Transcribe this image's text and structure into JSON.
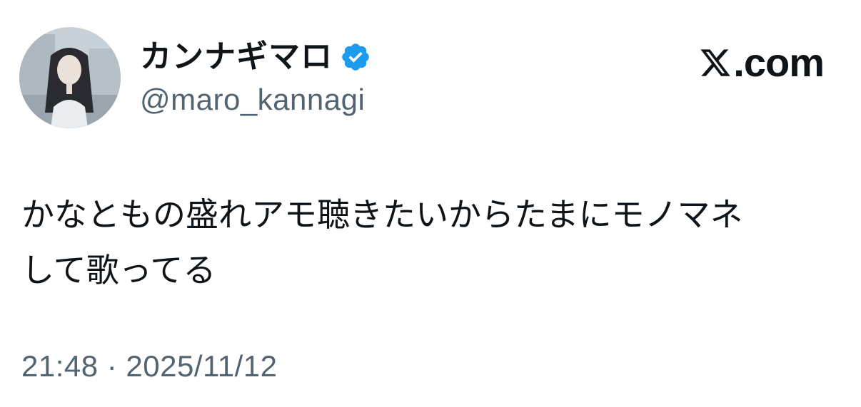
{
  "author": {
    "display_name": "カンナギマロ",
    "handle": "@maro_kannagi",
    "avatar_icon": "profile-photo",
    "verified_icon": "verified-badge-icon",
    "verified_color": "#1d9bf0"
  },
  "brand": {
    "icon": "x-logo-icon",
    "text": ".com"
  },
  "tweet": {
    "text": "かなともの盛れアモ聴きたいからたまにモノマネ\nして歌ってる",
    "timestamp": "21:48 · 2025/11/12"
  },
  "colors": {
    "text_primary": "#0f1419",
    "text_secondary": "#536471",
    "background": "#ffffff"
  }
}
